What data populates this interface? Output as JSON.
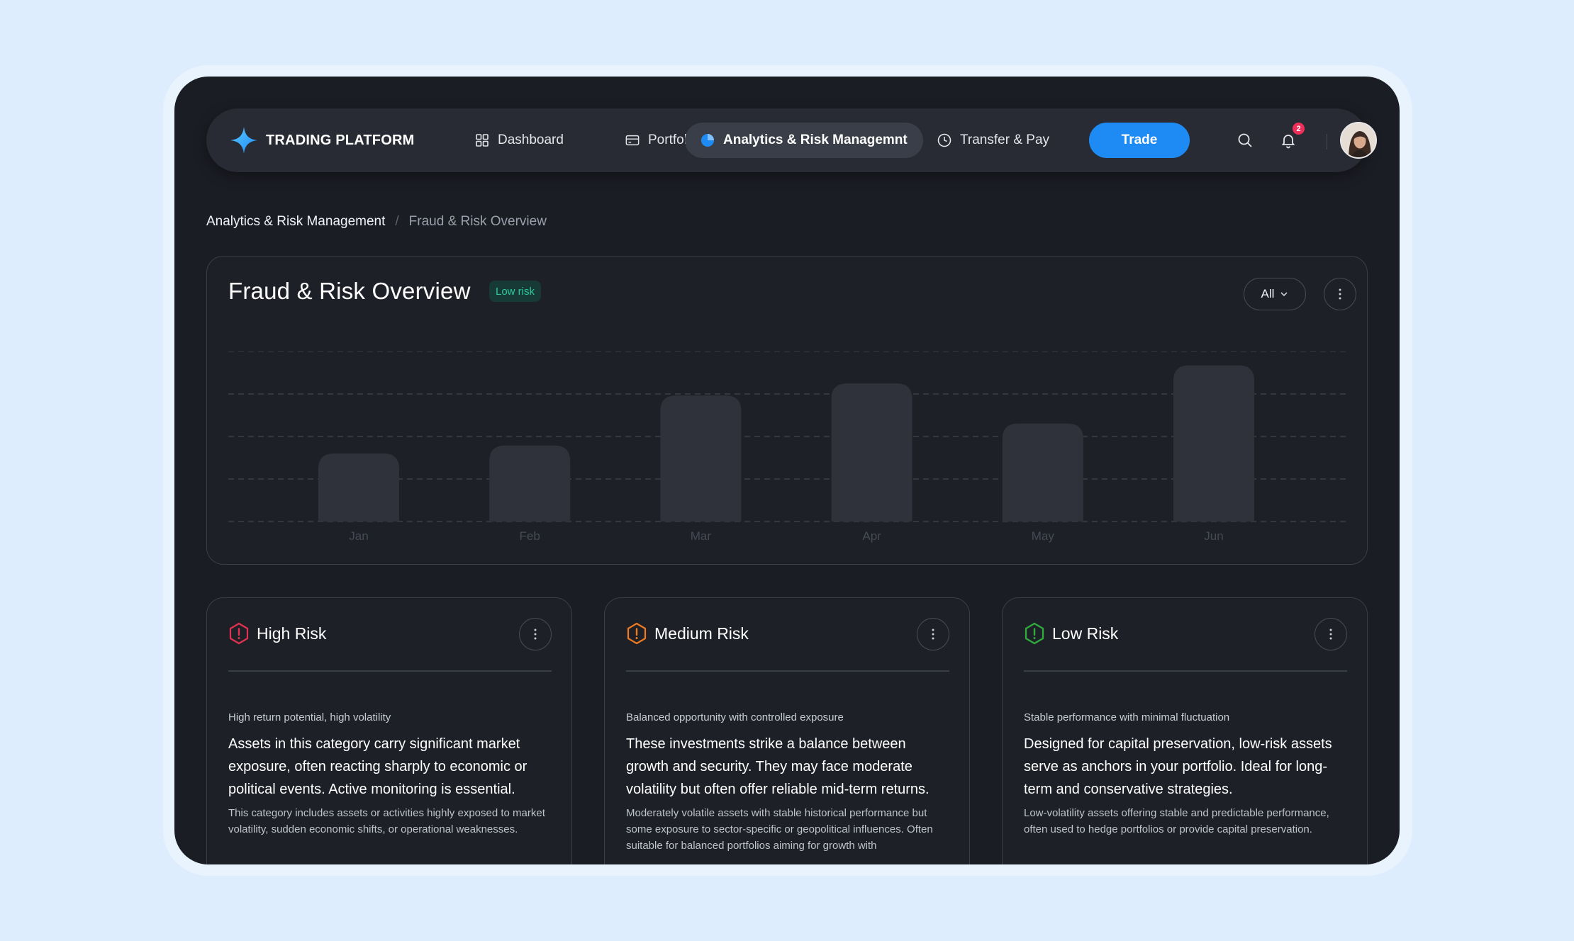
{
  "app": {
    "name": "TRADING PLATFORM",
    "accent": "#1e8bf5"
  },
  "nav": {
    "items": [
      {
        "label": "Dashboard",
        "icon": "grid-icon"
      },
      {
        "label": "Portfolio",
        "icon": "wallet-icon"
      },
      {
        "label": "Analytics & Risk Managemnt",
        "icon": "pie-chart-icon",
        "active": true
      },
      {
        "label": "Transfer & Pay",
        "icon": "clock-icon"
      }
    ],
    "trade_label": "Trade",
    "notifications_count": "2"
  },
  "breadcrumb": {
    "parent": "Analytics & Risk Management",
    "separator": "/",
    "current": "Fraud & Risk Overview"
  },
  "overview": {
    "title": "Fraud & Risk Overview",
    "status_badge": "Low risk",
    "filter_value": "All"
  },
  "chart_data": {
    "type": "bar",
    "categories": [
      "Jan",
      "Feb",
      "Mar",
      "Apr",
      "May",
      "Jun"
    ],
    "values": [
      40,
      44.7,
      74.1,
      81.2,
      57.6,
      91.8
    ],
    "ylim": [
      0,
      100
    ],
    "grid": true,
    "bar_color": "#2f323b"
  },
  "risk_cards": [
    {
      "name": "High Risk",
      "icon": "alert-hexagon-icon",
      "color": "#e5304f",
      "subtitle": "High return potential, high volatility",
      "body": "Assets in this category carry significant market exposure, often reacting sharply to economic or political events. Active monitoring is essential.",
      "footnote": "This category includes assets or activities highly exposed to market volatility, sudden economic shifts, or operational weaknesses."
    },
    {
      "name": "Medium Risk",
      "icon": "alert-hexagon-icon",
      "color": "#f07a1f",
      "subtitle": "Balanced opportunity with controlled exposure",
      "body": "These investments strike a balance between growth and security. They may face moderate volatility but often offer reliable mid-term returns.",
      "footnote": "Moderately volatile assets with stable historical performance but some exposure to sector-specific or geopolitical influences. Often suitable for balanced portfolios aiming for growth with"
    },
    {
      "name": "Low Risk",
      "icon": "alert-hexagon-icon",
      "color": "#2fae3c",
      "subtitle": "Stable performance with minimal fluctuation",
      "body": "Designed for capital preservation, low-risk assets serve as anchors in your portfolio. Ideal for long-term and conservative strategies.",
      "footnote": "Low-volatility assets offering stable and predictable performance, often used to hedge portfolios or provide capital preservation."
    }
  ]
}
